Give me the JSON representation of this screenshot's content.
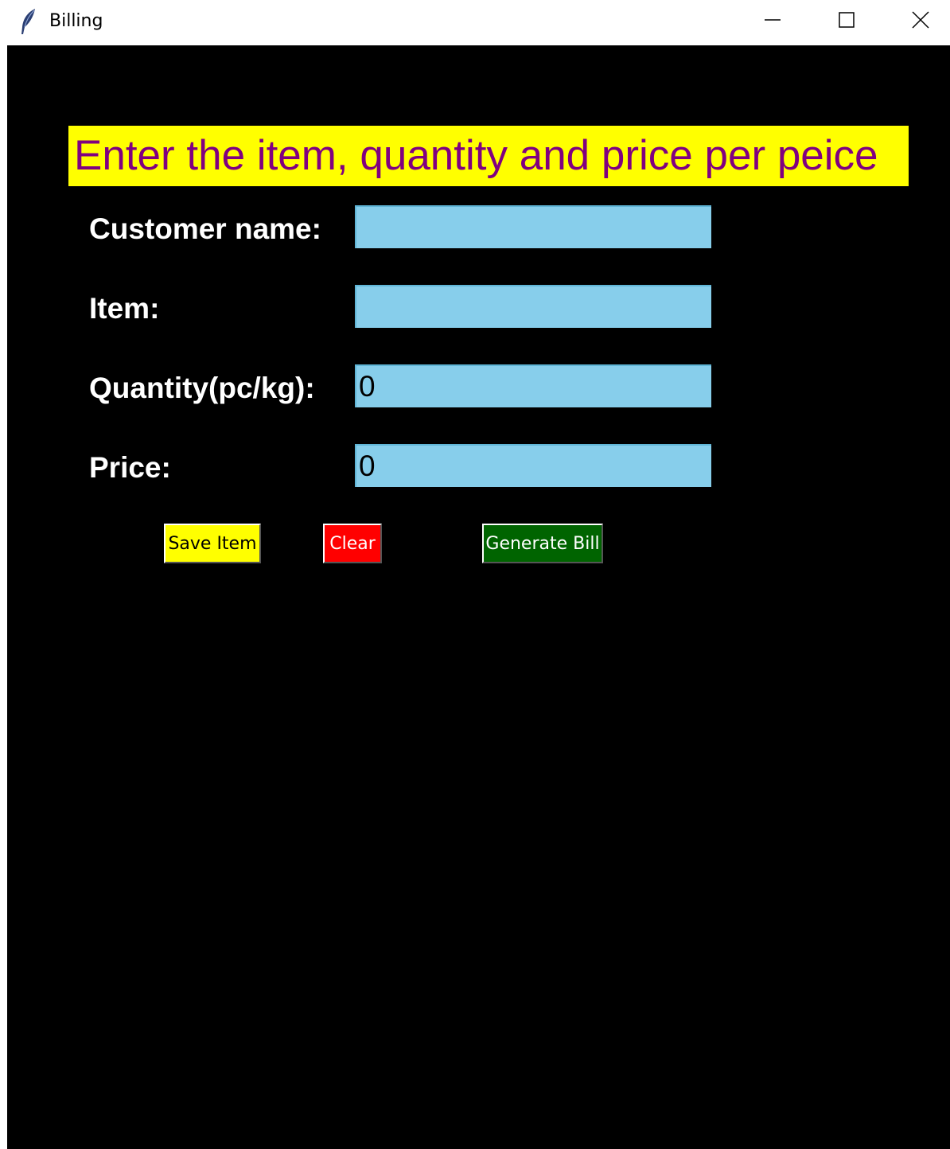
{
  "window": {
    "title": "Billing",
    "icon": "feather-icon",
    "controls": {
      "minimize_icon": "minimize-icon",
      "maximize_icon": "maximize-icon",
      "close_icon": "close-icon"
    }
  },
  "colors": {
    "background": "#000000",
    "banner_background": "#ffff00",
    "banner_text": "#800080",
    "input_background": "#87ceeb",
    "save_button": "#ffff00",
    "clear_button": "#ff0000",
    "generate_button": "#006400"
  },
  "banner": {
    "text": "Enter the item, quantity and price per peice"
  },
  "form": {
    "customer_name": {
      "label": "Customer name:",
      "value": ""
    },
    "item": {
      "label": "Item:",
      "value": ""
    },
    "quantity": {
      "label": "Quantity(pc/kg):",
      "value": "0"
    },
    "price": {
      "label": "Price:",
      "value": "0"
    }
  },
  "buttons": {
    "save_item": "Save Item",
    "clear": "Clear",
    "generate_bill": "Generate Bill"
  }
}
